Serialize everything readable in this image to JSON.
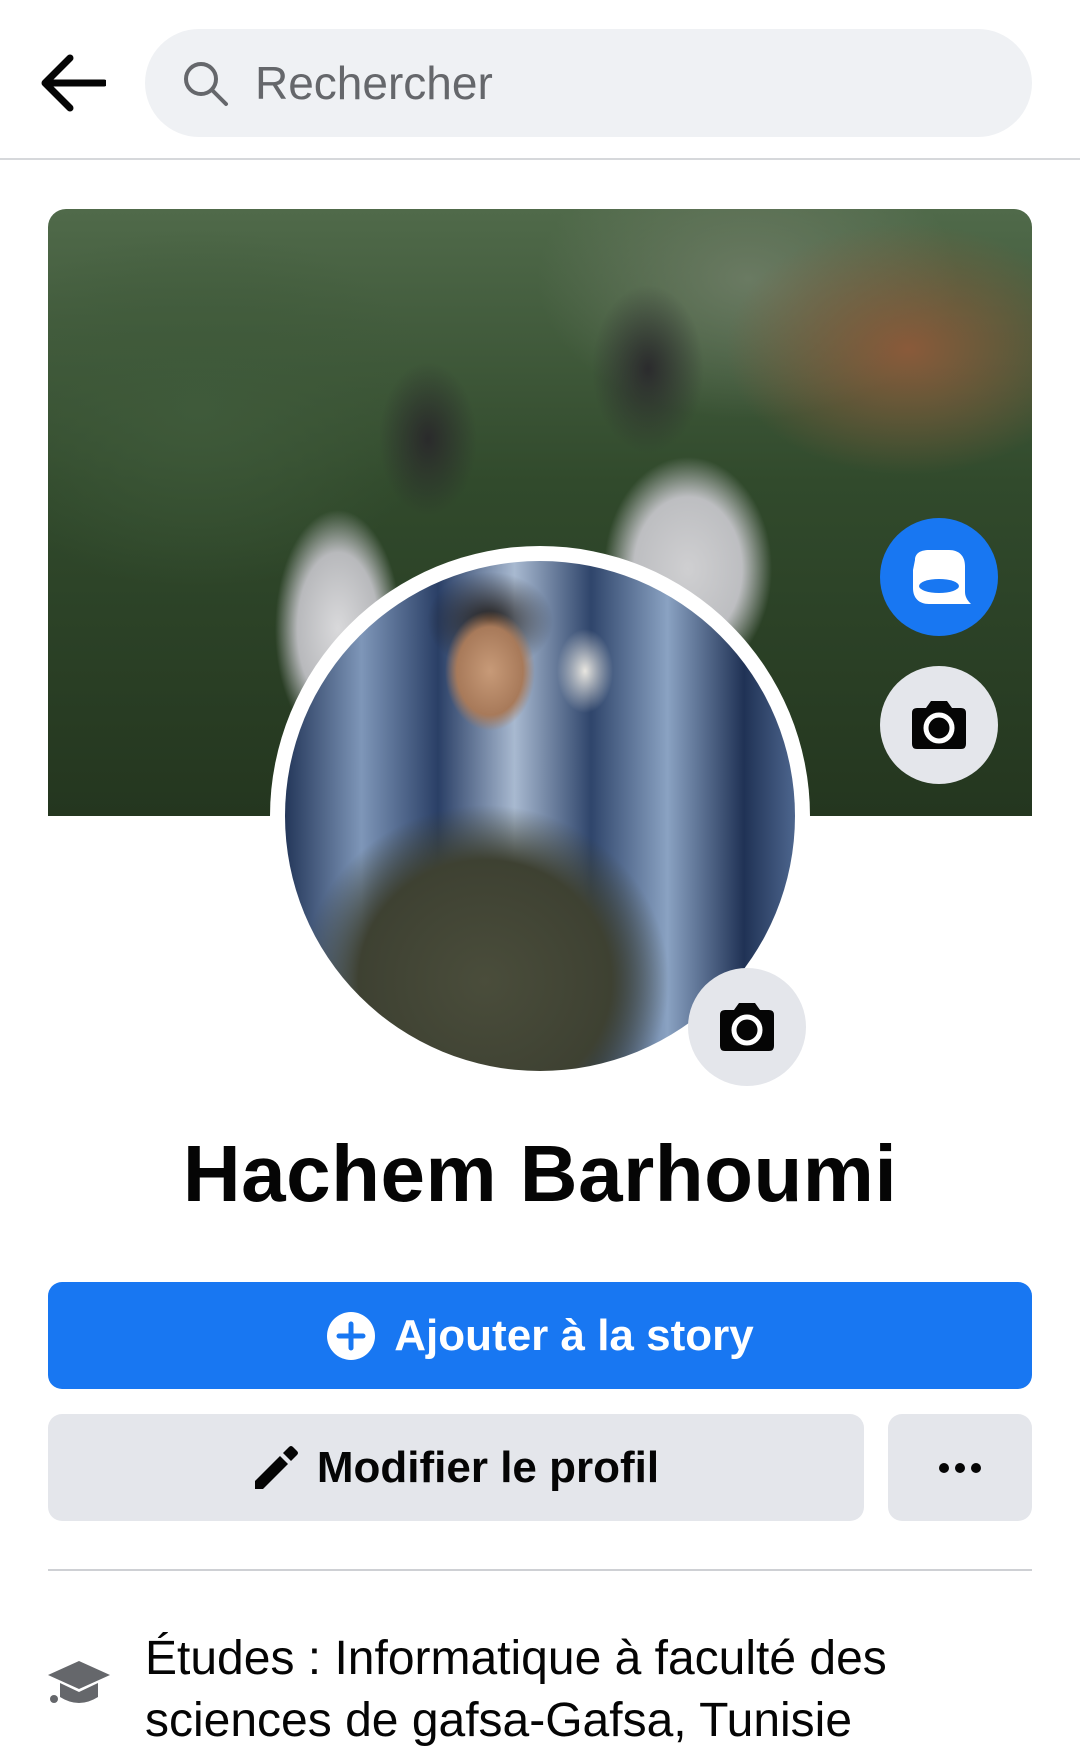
{
  "header": {
    "search_placeholder": "Rechercher"
  },
  "profile": {
    "name": "Hachem Barhoumi"
  },
  "actions": {
    "add_story": "Ajouter à la story",
    "edit_profile": "Modifier le profil"
  },
  "intro": {
    "education_line1": "Études : Informatique à faculté des",
    "education_line2": "sciences de gafsa-Gafsa, Tunisie"
  },
  "colors": {
    "primary": "#1877f2",
    "secondary_bg": "#e4e6eb",
    "text": "#050505",
    "muted": "#65676b"
  }
}
